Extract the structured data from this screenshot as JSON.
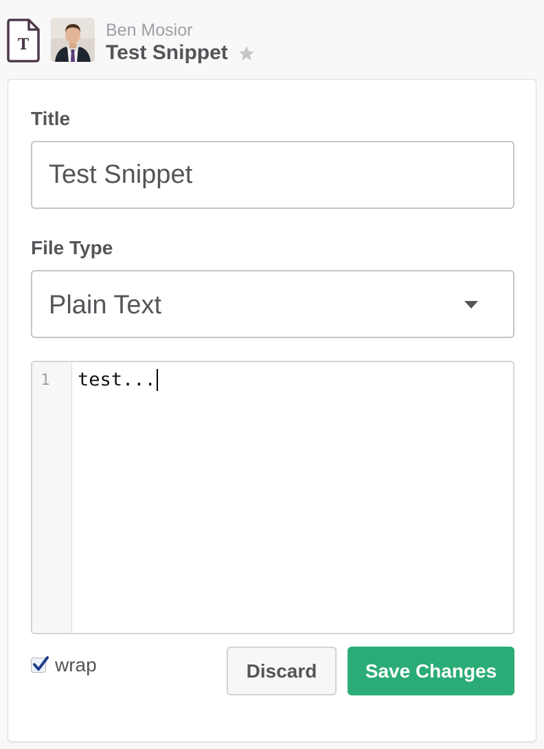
{
  "header": {
    "author": "Ben Mosior",
    "snippet_title": "Test Snippet",
    "file_icon_letter": "T",
    "file_icon_color": "#4d394b",
    "star_color": "#c7c7c7"
  },
  "form": {
    "title_label": "Title",
    "title_value": "Test Snippet",
    "file_type_label": "File Type",
    "file_type_value": "Plain Text",
    "editor": {
      "line_numbers": [
        "1"
      ],
      "lines": [
        "test..."
      ]
    },
    "wrap_label": "wrap",
    "wrap_checked": true,
    "discard_label": "Discard",
    "save_label": "Save Changes",
    "save_color": "#2bac76"
  }
}
